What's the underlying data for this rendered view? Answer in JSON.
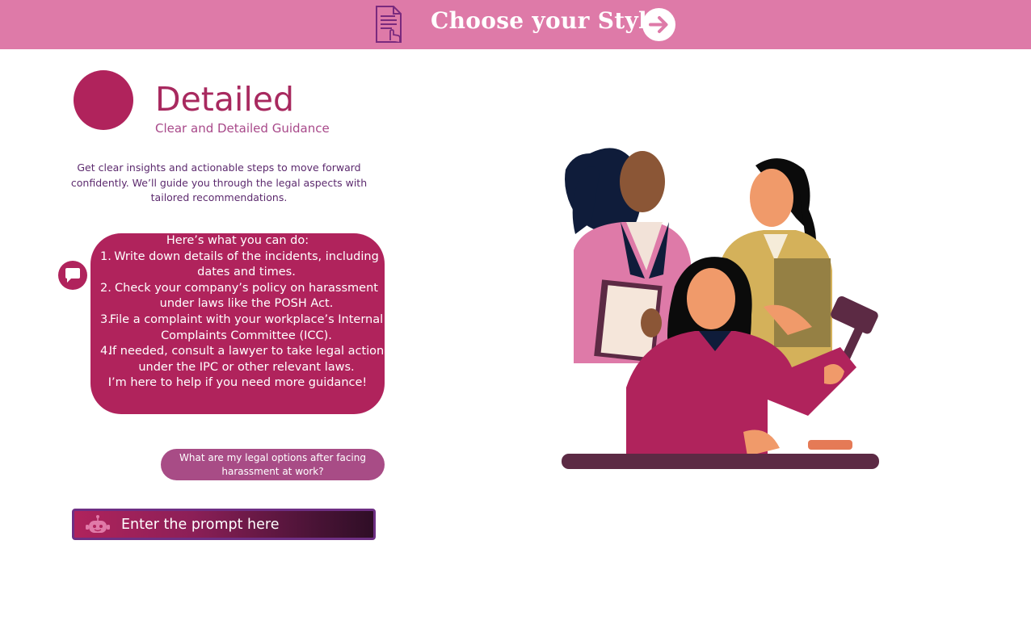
{
  "header": {
    "title": "Choose your Style",
    "doc_icon": "document-tap-icon",
    "next_icon": "arrow-right-circle-icon"
  },
  "style": {
    "name": "Detailed",
    "subtitle": "Clear and Detailed Guidance",
    "description": [
      "Get clear insights and actionable steps to move forward",
      "confidently. We’ll guide you through the legal aspects with",
      "tailored recommendations."
    ]
  },
  "chat": {
    "assistant_icon": "speech-bubble-icon",
    "answer": {
      "intro": "Here’s what you can do:",
      "items": [
        {
          "num": "1.",
          "lines": [
            "Write down details of the incidents, including",
            "dates and times."
          ]
        },
        {
          "num": "2.",
          "lines": [
            "Check your company’s policy on harassment",
            "under laws like the POSH Act."
          ]
        },
        {
          "num": "3.",
          "lines": [
            "File a complaint with your workplace’s Internal",
            "Complaints Committee (ICC)."
          ]
        },
        {
          "num": "4.",
          "lines": [
            "If needed, consult a lawyer to take legal action",
            "under the IPC or other relevant laws."
          ]
        }
      ],
      "outro": "I’m here to help if you need more guidance!"
    },
    "question": [
      "What are my legal options after facing",
      "harassment at work?"
    ]
  },
  "prompt": {
    "placeholder": "Enter the prompt here",
    "icon": "robot-icon"
  },
  "illustration": {
    "name": "women-with-legal-documents-and-gavel-illustration"
  },
  "colors": {
    "topbar": "#de7aa8",
    "accent": "#b0235c",
    "question_bubble": "#a84c86",
    "text_purple": "#5c2a6e"
  }
}
